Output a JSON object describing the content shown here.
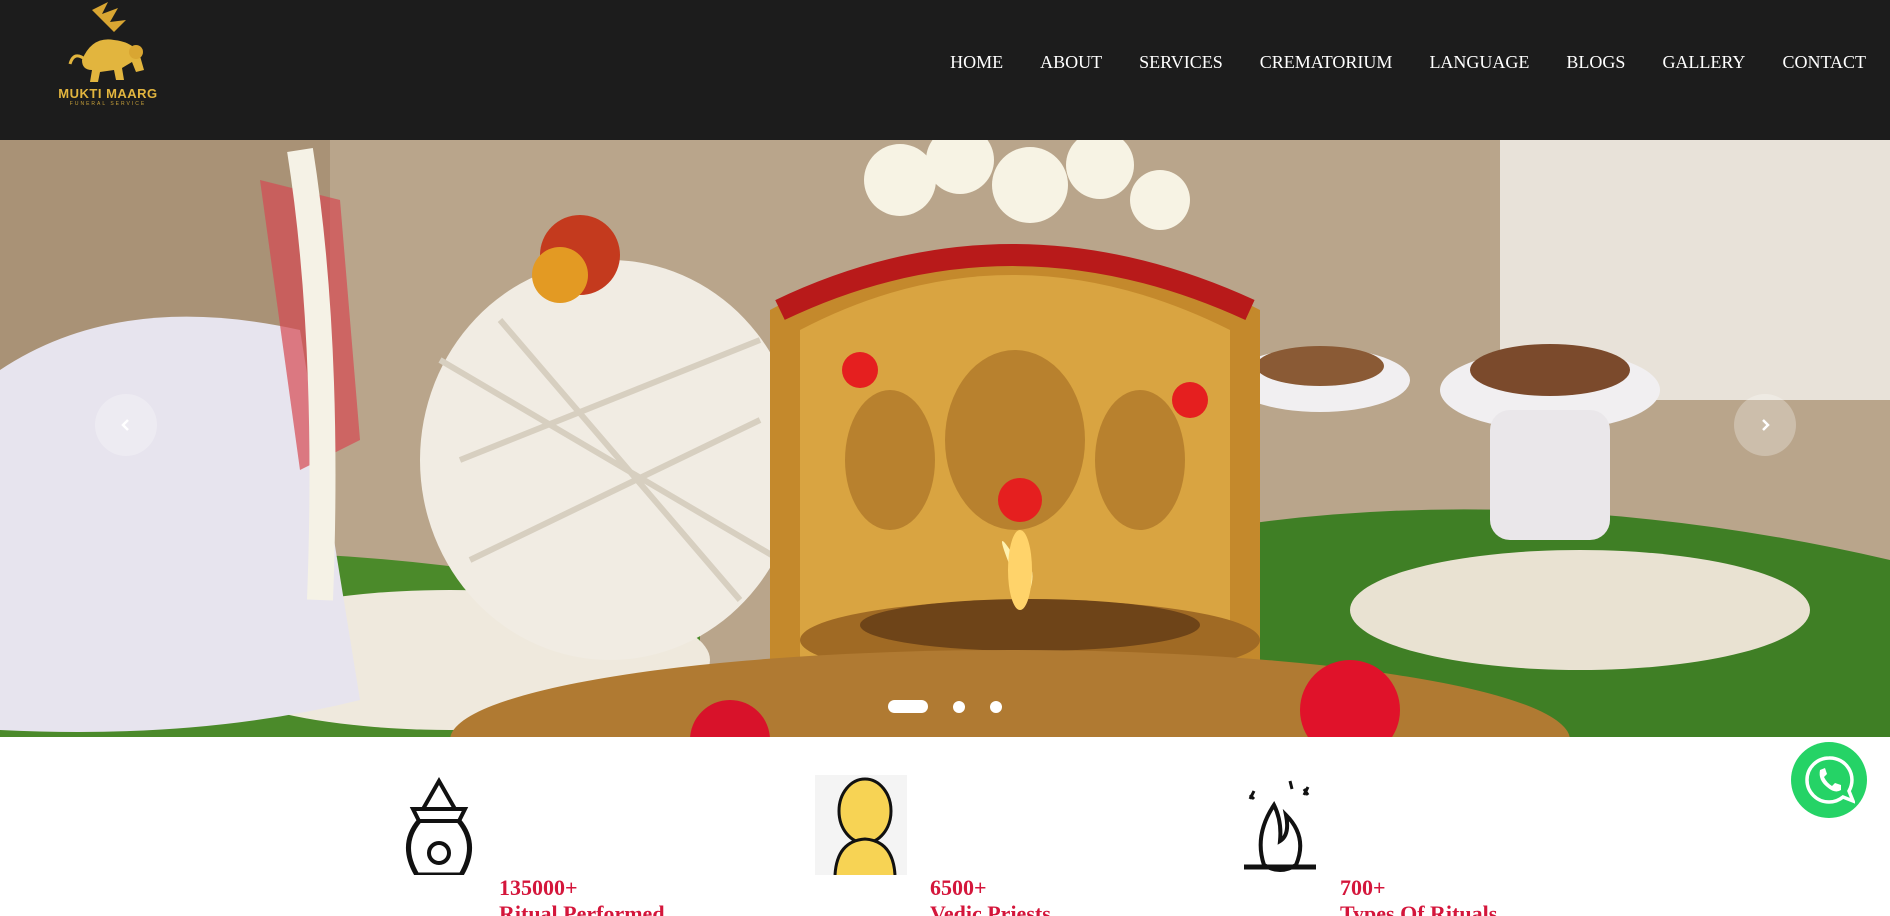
{
  "brand": {
    "logo_text": "MUKTI MAARG",
    "logo_subtext": "FUNERAL SERVICE"
  },
  "nav": {
    "items": [
      "HOME",
      "ABOUT",
      "SERVICES",
      "CREMATORIUM",
      "LANGUAGE",
      "BLOGS",
      "GALLERY",
      "CONTACT"
    ]
  },
  "hero": {
    "slide_count": 3,
    "active_slide": 1
  },
  "stats": [
    {
      "number": "135000+",
      "label": "Ritual Performed",
      "icon": "kalash-icon"
    },
    {
      "number": "6500+",
      "label": "Vedic Priests",
      "icon": "priest-icon"
    },
    {
      "number": "700+",
      "label": "Types Of Rituals",
      "icon": "havan-fire-icon"
    }
  ],
  "colors": {
    "header_bg": "#1c1c1c",
    "accent_red": "#d4163b",
    "logo_gold": "#e2b53e",
    "whatsapp_green": "#25d366"
  }
}
